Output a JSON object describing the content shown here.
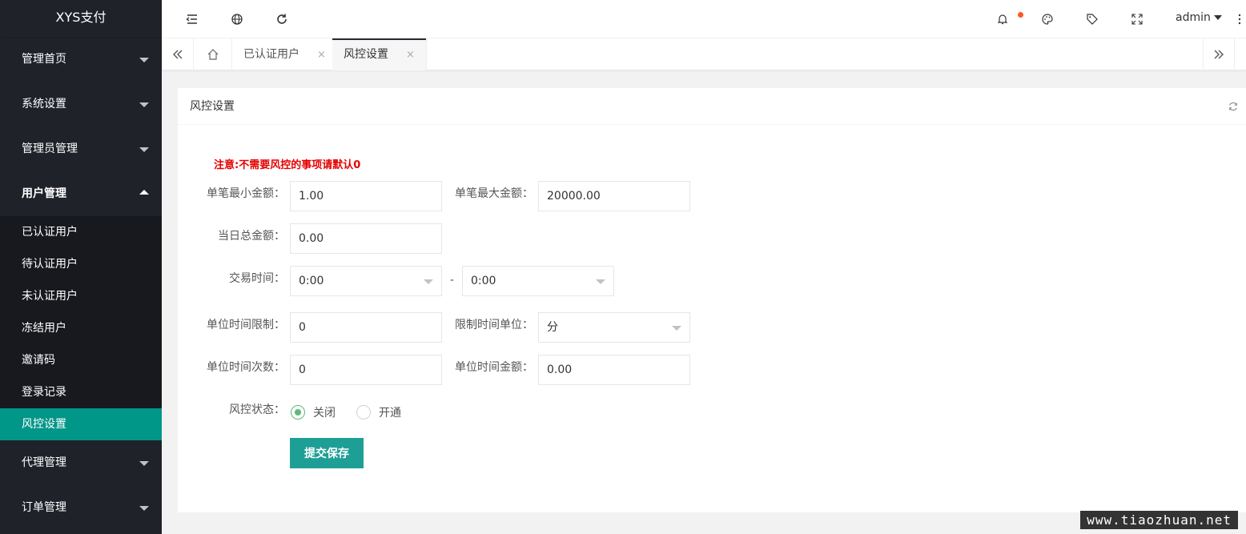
{
  "app": {
    "title": "XYS支付"
  },
  "sidebar": {
    "groups": [
      {
        "label": "管理首页"
      },
      {
        "label": "系统设置"
      },
      {
        "label": "管理员管理"
      },
      {
        "label": "用户管理"
      },
      {
        "label": "代理管理"
      },
      {
        "label": "订单管理"
      }
    ],
    "user_sub": [
      {
        "label": "已认证用户"
      },
      {
        "label": "待认证用户"
      },
      {
        "label": "未认证用户"
      },
      {
        "label": "冻结用户"
      },
      {
        "label": "邀请码"
      },
      {
        "label": "登录记录"
      },
      {
        "label": "风控设置"
      }
    ]
  },
  "header": {
    "username": "admin"
  },
  "tabs": [
    {
      "label": "已认证用户",
      "close": "×"
    },
    {
      "label": "风控设置",
      "close": "×"
    }
  ],
  "card": {
    "title": "风控设置",
    "notice": "注意:不需要风控的事项请默认0",
    "fields": {
      "min_amount": {
        "label": "单笔最小金额：",
        "value": "1.00"
      },
      "max_amount": {
        "label": "单笔最大金额：",
        "value": "20000.00"
      },
      "daily_total": {
        "label": "当日总金额：",
        "value": "0.00"
      },
      "trade_time": {
        "label": "交易时间：",
        "start": "0:00",
        "sep": "-",
        "end": "0:00"
      },
      "unit_time_limit": {
        "label": "单位时间限制：",
        "value": "0"
      },
      "limit_time_unit": {
        "label": "限制时间单位：",
        "value": "分"
      },
      "unit_time_count": {
        "label": "单位时间次数：",
        "value": "0"
      },
      "unit_time_amount": {
        "label": "单位时间金额：",
        "value": "0.00"
      },
      "risk_status": {
        "label": "风控状态：",
        "options": [
          "关闭",
          "开通"
        ],
        "selected": "关闭"
      }
    },
    "submit_label": "提交保存"
  },
  "watermark": "www.tiaozhuan.net",
  "colors": {
    "sidebar_bg": "#20222a",
    "active": "#009688",
    "primary_button": "#1e9f95",
    "notice": "#e60000",
    "radio_on": "#5fb878"
  }
}
